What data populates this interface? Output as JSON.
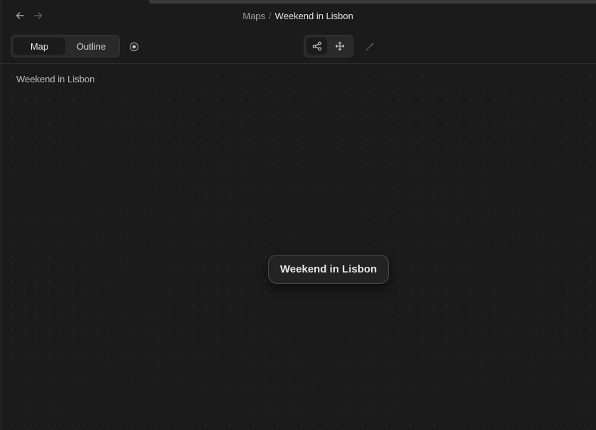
{
  "breadcrumb": {
    "parent": "Maps",
    "separator": "/",
    "current": "Weekend in Lisbon"
  },
  "nav": {
    "back_icon": "arrow-left-icon",
    "forward_icon": "arrow-right-icon"
  },
  "view_switcher": {
    "selected": "Map",
    "options": [
      "Map",
      "Outline"
    ]
  },
  "toolbar": {
    "focus_icon": "radio-target-icon",
    "mode_buttons": [
      {
        "icon": "share-nodes-icon",
        "active": true
      },
      {
        "icon": "move-arrows-icon",
        "active": false
      }
    ],
    "draw_icon": "pen-line-icon"
  },
  "canvas": {
    "title": "Weekend in Lisbon",
    "root_node": "Weekend in Lisbon"
  },
  "colors": {
    "background": "#1b1b1b",
    "panel": "#2a2a2a",
    "node_border": "#4a4a4a",
    "text": "#e4e4e4",
    "muted_text": "#9a9a9a"
  }
}
